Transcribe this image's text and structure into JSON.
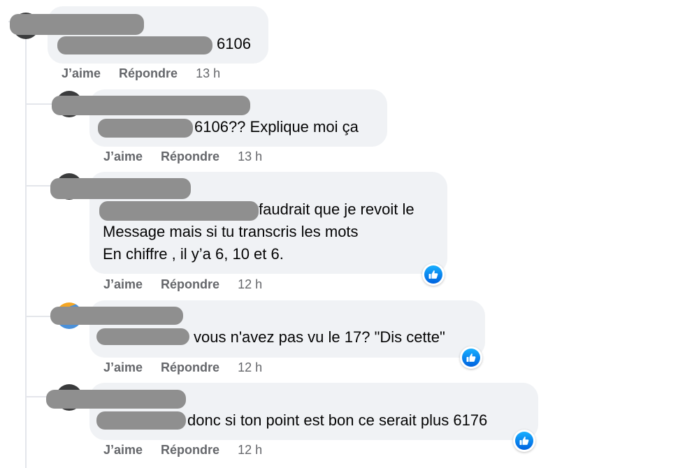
{
  "comments": [
    {
      "text": "6106",
      "actions": {
        "like": "J’aime",
        "reply": "Répondre",
        "time": "13 h"
      }
    },
    {
      "text": "6106?? Explique moi ça",
      "actions": {
        "like": "J’aime",
        "reply": "Répondre",
        "time": "13 h"
      }
    },
    {
      "lines": [
        "faudrait que je revoit le",
        "Message mais si tu transcris les mots",
        "En chiffre , il y’a 6, 10 et 6."
      ],
      "actions": {
        "like": "J’aime",
        "reply": "Répondre",
        "time": "12 h"
      },
      "reaction": "like-reaction-icon"
    },
    {
      "text": "vous n'avez pas vu le 17? \"Dis cette\"",
      "actions": {
        "like": "J’aime",
        "reply": "Répondre",
        "time": "12 h"
      },
      "reaction": "like-reaction-icon"
    },
    {
      "text": "donc si ton point est bon ce serait plus 6176",
      "actions": {
        "like": "J’aime",
        "reply": "Répondre",
        "time": "12 h"
      },
      "reaction": "like-reaction-icon"
    }
  ],
  "colors": {
    "bubble": "#f0f2f5",
    "redaction": "#8f8f8f",
    "action_text": "#65676b",
    "like_blue": "#1877f2"
  }
}
